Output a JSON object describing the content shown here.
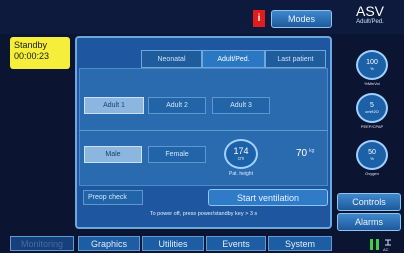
{
  "status": {
    "state": "Standby",
    "timer": "00:00:23"
  },
  "alarm_indicator": "i",
  "modes_label": "Modes",
  "mode": {
    "name": "ASV",
    "sub": "Adult/Ped."
  },
  "patient_group_tabs": [
    "Neonatal",
    "Adult/Ped.",
    "Last patient"
  ],
  "adult_options": [
    "Adult 1",
    "Adult 2",
    "Adult 3"
  ],
  "gender_options": [
    "Male",
    "Female"
  ],
  "height": {
    "value": "174",
    "unit": "cm",
    "label": "Pat. height"
  },
  "weight": {
    "value": "70",
    "unit": "kg"
  },
  "preop_label": "Preop check",
  "start_label": "Start ventilation",
  "power_note": "To power off, press power/standby key > 3 s",
  "controls": [
    {
      "value": "100",
      "unit": "%",
      "label": "%MinVol"
    },
    {
      "value": "5",
      "unit": "cmH2O",
      "label": "PEEP/CPAP"
    },
    {
      "value": "50",
      "unit": "%",
      "label": "Oxygen"
    }
  ],
  "side_buttons": {
    "controls": "Controls",
    "alarms": "Alarms"
  },
  "nav": [
    "Monitoring",
    "Graphics",
    "Utilities",
    "Events",
    "System"
  ],
  "colors": {
    "standby_yellow": "#f5ee3a",
    "alarm_red": "#e21b1b",
    "accent_blue": "#2b78c2"
  }
}
